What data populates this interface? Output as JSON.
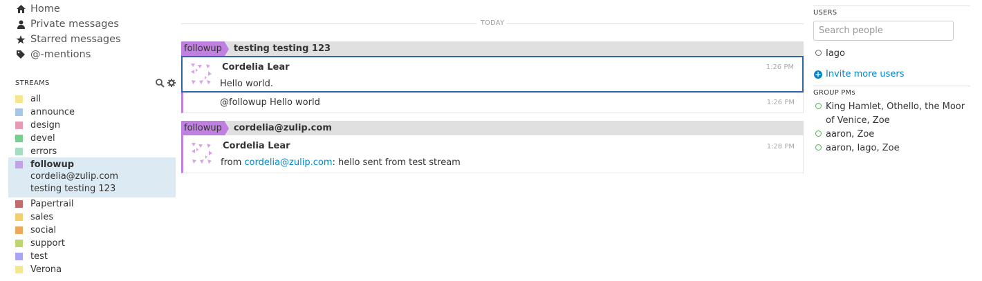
{
  "nav": {
    "home": "Home",
    "private": "Private messages",
    "starred": "Starred messages",
    "mentions": "@-mentions"
  },
  "streams_header": "STREAMS",
  "streams": [
    {
      "name": "all",
      "color": "#f5e78f"
    },
    {
      "name": "announce",
      "color": "#a6c7e5"
    },
    {
      "name": "design",
      "color": "#e79ab5"
    },
    {
      "name": "devel",
      "color": "#76ce90"
    },
    {
      "name": "errors",
      "color": "#a6dcbf"
    },
    {
      "name": "followup",
      "color": "#c2a2e6"
    },
    {
      "name": "Papertrail",
      "color": "#c06c6c"
    },
    {
      "name": "sales",
      "color": "#f5ce6e"
    },
    {
      "name": "social",
      "color": "#eda85b"
    },
    {
      "name": "support",
      "color": "#bfd56f"
    },
    {
      "name": "test",
      "color": "#a6a6f5"
    },
    {
      "name": "Verona",
      "color": "#f5e78f"
    }
  ],
  "active_topics": [
    "cordelia@zulip.com",
    "testing testing 123"
  ],
  "date_divider": "TODAY",
  "groups": [
    {
      "stream": "followup",
      "topic": "testing testing 123",
      "messages": [
        {
          "sender": "Cordelia Lear",
          "content": "Hello world.",
          "time": "1:26 PM"
        },
        {
          "sender": "",
          "content": "@followup Hello world",
          "time": "1:26 PM"
        }
      ]
    },
    {
      "stream": "followup",
      "topic": "cordelia@zulip.com",
      "messages": [
        {
          "sender": "Cordelia Lear",
          "content_prefix": "from ",
          "content_link": "cordelia@zulip.com",
          "content_suffix": ": hello sent from test stream",
          "time": "1:28 PM"
        }
      ]
    }
  ],
  "right": {
    "users_header": "USERS",
    "search_placeholder": "Search people",
    "users": [
      "Iago"
    ],
    "invite": "Invite more users",
    "group_pms_header": "GROUP PMs",
    "group_pms": [
      "King Hamlet, Othello, the Moor of Venice, Zoe",
      "aaron, Zoe",
      "aaron, Iago, Zoe"
    ]
  },
  "colors": {
    "accent": "#0088cc",
    "stream_followup": "#c080e0",
    "selected_border": "#2f64ad",
    "active_bg": "#dcebf3"
  },
  "icons": [
    "home-icon",
    "user-icon",
    "star-icon",
    "tag-icon",
    "search-icon",
    "gear-icon",
    "plus-circle-icon"
  ]
}
